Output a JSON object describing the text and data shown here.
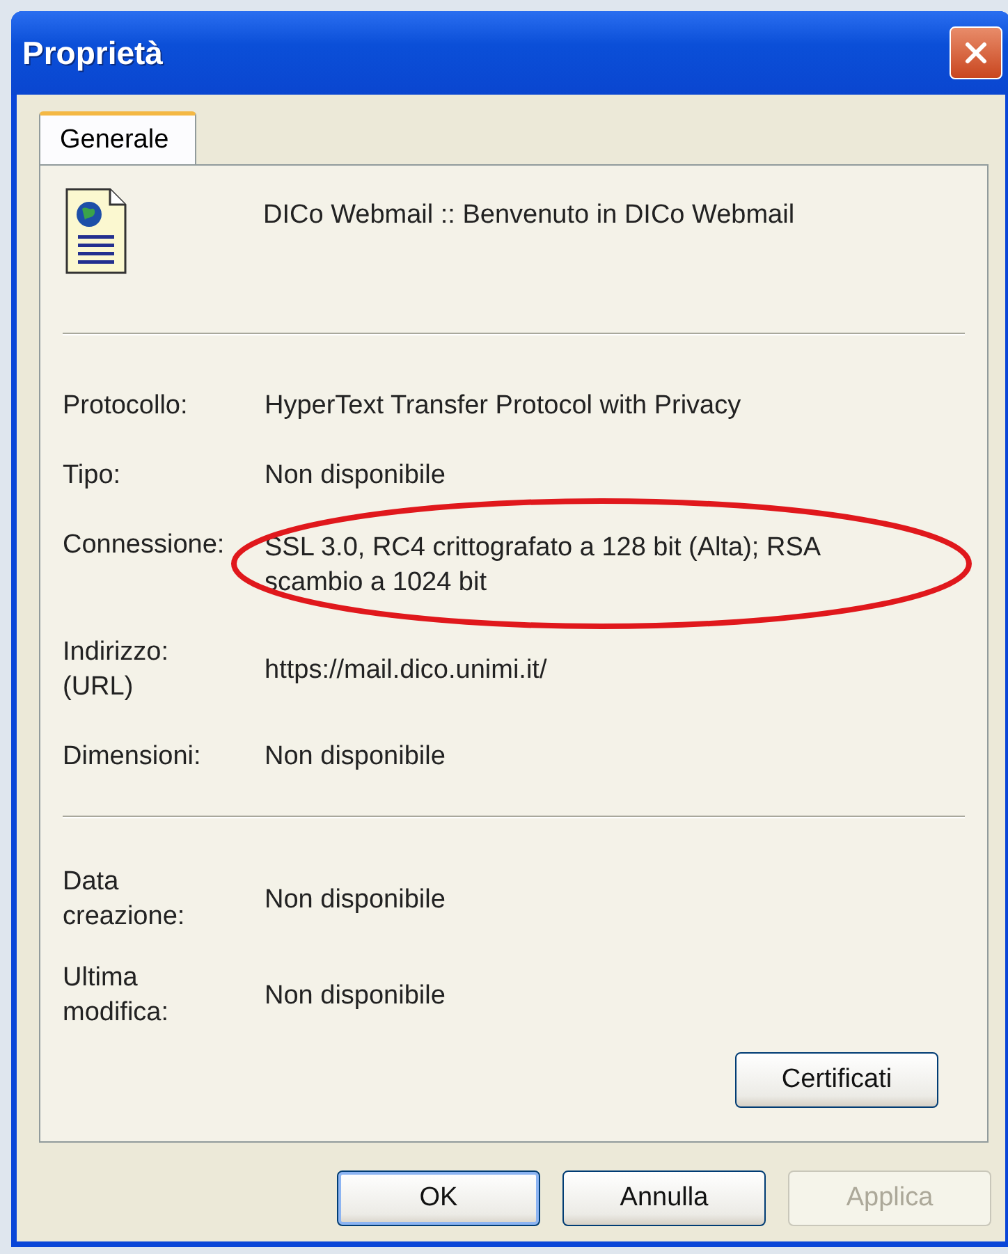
{
  "window": {
    "title": "Proprietà"
  },
  "tabs": [
    {
      "label": "Generale",
      "selected": true
    }
  ],
  "header": {
    "title": "DICo Webmail :: Benvenuto in DICo Webmail"
  },
  "groups": [
    {
      "rows": [
        {
          "label": "Protocollo:",
          "value": "HyperText Transfer Protocol with Privacy"
        },
        {
          "label": "Tipo:",
          "value": "Non disponibile"
        },
        {
          "label": "Connessione:",
          "value": "SSL 3.0, RC4 crittografato a 128 bit (Alta); RSA scambio a 1024 bit",
          "highlighted": true
        },
        {
          "label": "Indirizzo: (URL)",
          "value": "https://mail.dico.unimi.it/"
        },
        {
          "label": "Dimensioni:",
          "value": "Non disponibile"
        }
      ]
    },
    {
      "rows": [
        {
          "label": "Data creazione:",
          "value": "Non disponibile"
        },
        {
          "label": "Ultima modifica:",
          "value": "Non disponibile"
        }
      ]
    }
  ],
  "panel_button": {
    "label": "Certificati"
  },
  "buttons": [
    {
      "label": "OK",
      "default": true,
      "disabled": false
    },
    {
      "label": "Annulla",
      "default": false,
      "disabled": false
    },
    {
      "label": "Applica",
      "default": false,
      "disabled": true
    }
  ]
}
